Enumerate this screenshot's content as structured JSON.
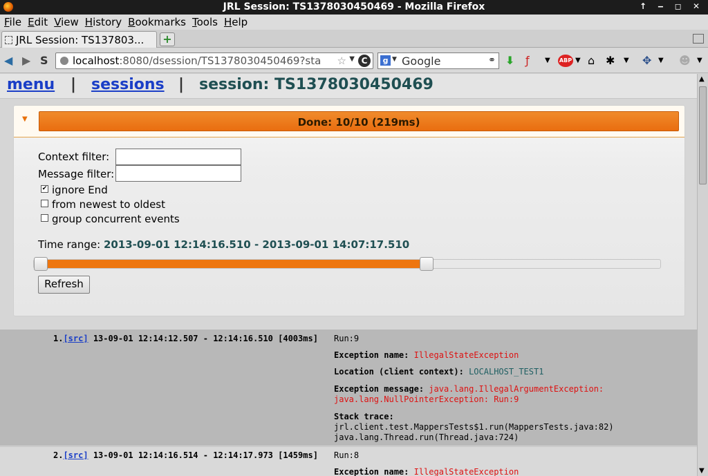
{
  "window": {
    "title": "JRL Session: TS1378030450469 - Mozilla Firefox",
    "controls": "↑ ‒ ◻ ✕"
  },
  "menu": [
    "File",
    "Edit",
    "View",
    "History",
    "Bookmarks",
    "Tools",
    "Help"
  ],
  "tab": {
    "label": "JRL Session: TS137803...",
    "new_tab": "+"
  },
  "nav": {
    "url_host": "localhost",
    "url_rest": ":8080/dsession/TS1378030450469?sta",
    "search_engine": "Google"
  },
  "header": {
    "menu_link": "menu",
    "separator": "|",
    "sessions_link": "sessions",
    "session_title": "session: TS1378030450469"
  },
  "panel": {
    "progress_label": "Done: 10/10 (219ms)",
    "progress_fraction": 1.0,
    "context_filter_label": "Context filter:",
    "context_filter_value": "",
    "message_filter_label": "Message filter:",
    "message_filter_value": "",
    "checkboxes": [
      {
        "label": "ignore End",
        "checked": true
      },
      {
        "label": "from newest to oldest",
        "checked": false
      },
      {
        "label": "group concurrent events",
        "checked": false
      }
    ],
    "time_range_label": "Time range:",
    "time_range_value": "2013-09-01 12:14:16.510 - 2013-09-01 14:07:17.510",
    "slider_low": 0.0,
    "slider_high": 0.63,
    "refresh_label": "Refresh"
  },
  "results": [
    {
      "index": "1.",
      "src": "[src]",
      "times": "13-09-01 12:14:12.507 - 12:14:16.510 [4003ms]",
      "run": "Run:9",
      "exception_name_key": "Exception name:",
      "exception_name": "IllegalStateException",
      "location_key": "Location (client context):",
      "location": "LOCALHOST_TEST1",
      "message_key": "Exception message:",
      "message_line1": "java.lang.IllegalArgumentException:",
      "message_line2": "java.lang.NullPointerException: Run:9",
      "stack_key": "Stack trace:",
      "stack_line1": "jrl.client.test.MappersTests$1.run(MappersTests.java:82)",
      "stack_line2": "java.lang.Thread.run(Thread.java:724)"
    },
    {
      "index": "2.",
      "src": "[src]",
      "times": "13-09-01 12:14:16.514 - 12:14:17.973 [1459ms]",
      "run": "Run:8",
      "exception_name_key": "Exception name:",
      "exception_name": "IllegalStateException"
    }
  ],
  "colors": {
    "accent_orange": "#ee7610",
    "link_blue": "#1a3ec7",
    "error_red": "#dd1111",
    "teal": "#1f4f52"
  }
}
